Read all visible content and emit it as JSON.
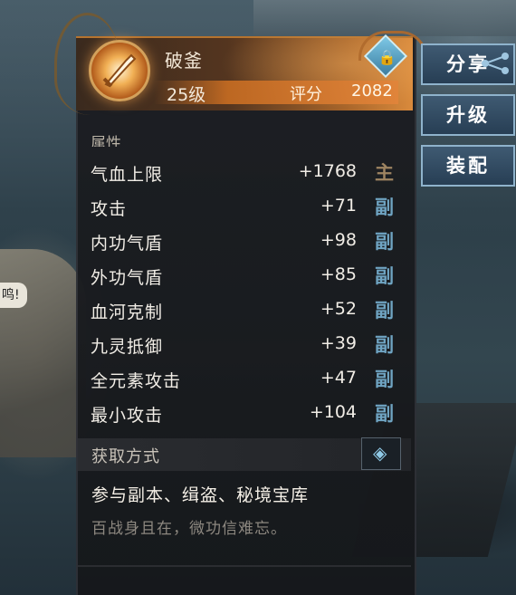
{
  "item": {
    "name": "破釜",
    "level": "25级",
    "score_label": "评分",
    "score_value": "2082",
    "icon": "sword-flame-icon",
    "lock_icon": "lock-icon",
    "lock_glyph": "🔒"
  },
  "section_header_partial": "属性",
  "attributes": [
    {
      "name": "气血上限",
      "value": "+1768",
      "tag": "主"
    },
    {
      "name": "攻击",
      "value": "+71",
      "tag": "副"
    },
    {
      "name": "内功气盾",
      "value": "+98",
      "tag": "副"
    },
    {
      "name": "外功气盾",
      "value": "+85",
      "tag": "副"
    },
    {
      "name": "血河克制",
      "value": "+52",
      "tag": "副"
    },
    {
      "name": "九灵抵御",
      "value": "+39",
      "tag": "副"
    },
    {
      "name": "全元素攻击",
      "value": "+47",
      "tag": "副"
    },
    {
      "name": "最小攻击",
      "value": "+104",
      "tag": "副"
    }
  ],
  "acquire": {
    "label": "获取方式",
    "arrow_glyph": "◈",
    "text": "参与副本、缉盗、秘境宝库",
    "flavor": "百战身且在，微功信难忘。"
  },
  "buttons": {
    "share": "分享",
    "upgrade": "升级",
    "equip": "装配"
  },
  "background": {
    "speech_bubble": "鸣!"
  },
  "colors": {
    "header_orange": "#d98a3c",
    "main_tag": "#9e8461",
    "sub_tag": "#6fa4c2",
    "button_blue": "#3f5a72"
  }
}
